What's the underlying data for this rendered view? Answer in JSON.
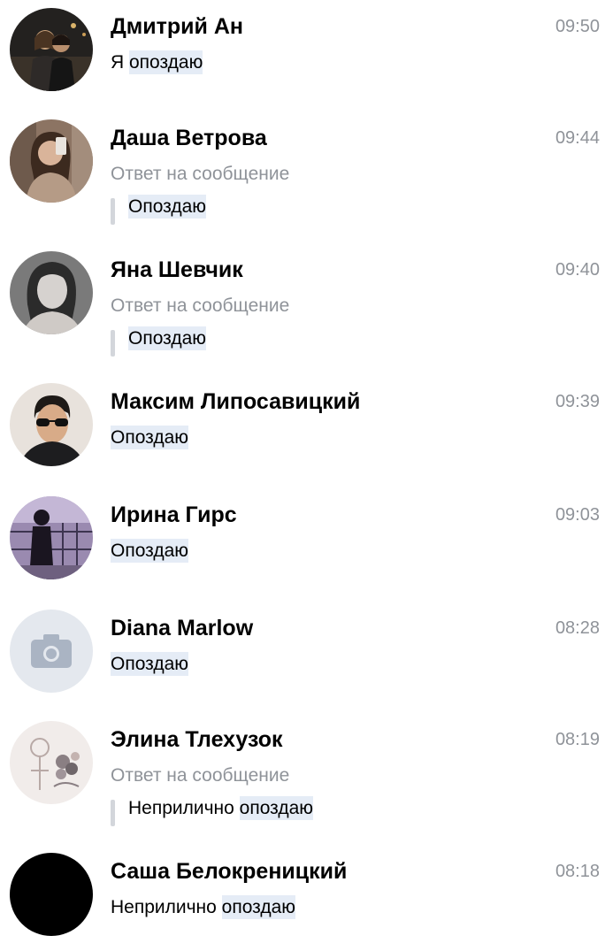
{
  "chats": [
    {
      "name": "Дмитрий Ан",
      "time": "09:50",
      "prefix": "Я ",
      "highlight": "опоздаю",
      "avatar_icon": "photo-avatar-couple-night"
    },
    {
      "name": "Даша Ветрова",
      "time": "09:44",
      "reply_caption": "Ответ на сообщение",
      "quote_prefix": "",
      "quote_highlight": "Опоздаю",
      "avatar_icon": "photo-avatar-selfie"
    },
    {
      "name": "Яна Шевчик",
      "time": "09:40",
      "reply_caption": "Ответ на сообщение",
      "quote_prefix": "",
      "quote_highlight": "Опоздаю",
      "avatar_icon": "photo-avatar-portrait-bw"
    },
    {
      "name": "Максим Липосавицкий",
      "time": "09:39",
      "prefix": "",
      "highlight": "Опоздаю",
      "avatar_icon": "photo-avatar-sunglasses"
    },
    {
      "name": "Ирина Гирс",
      "time": "09:03",
      "prefix": "",
      "highlight": "Опоздаю",
      "avatar_icon": "photo-avatar-silhouette-purple"
    },
    {
      "name": "Diana Marlow",
      "time": "08:28",
      "prefix": "",
      "highlight": "Опоздаю",
      "avatar_icon": "camera-placeholder-icon"
    },
    {
      "name": "Элина Тлехузок",
      "time": "08:19",
      "reply_caption": "Ответ на сообщение",
      "quote_prefix": "Неприлично ",
      "quote_highlight": "опоздаю",
      "avatar_icon": "photo-avatar-illustration"
    },
    {
      "name": "Саша Белокреницкий",
      "time": "08:18",
      "prefix": "Неприлично ",
      "highlight": "опоздаю",
      "avatar_icon": "photo-avatar-black"
    }
  ],
  "colors": {
    "name_text": "#000000",
    "secondary_text": "#8f9399",
    "highlight_bg": "#e5ecf6",
    "quote_bar": "#d3d6db",
    "placeholder_avatar_bg": "#e4e8ee",
    "placeholder_icon": "#aab4c3"
  }
}
